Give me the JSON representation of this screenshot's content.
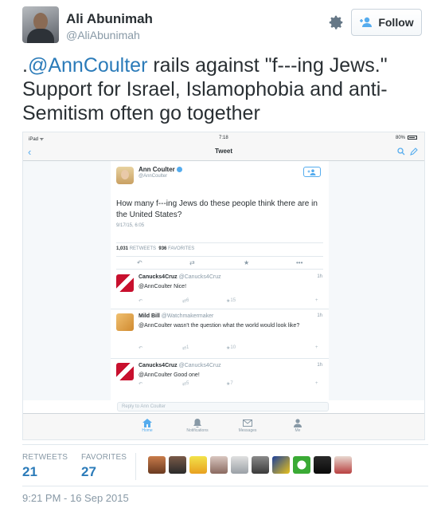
{
  "author": {
    "name": "Ali Abunimah",
    "handle": "@AliAbunimah",
    "follow_label": "Follow",
    "gear_icon": "gear-icon"
  },
  "tweet": {
    "prefix": ".",
    "mention": "@AnnCoulter",
    "text": " rails against \"f---ing Jews.\" Support for Israel, Islamophobia and anti-Semitism often go together"
  },
  "embedded": {
    "status_left": "iPad ᯤ",
    "status_time": "7:18",
    "status_battery": "80%",
    "nav_title": "Tweet",
    "main": {
      "name": "Ann Coulter",
      "handle": "@AnnCoulter",
      "text": "How many f---ing Jews do these people think there are in the United States?",
      "date": "9/17/15, 6:05",
      "retweets": "1,031",
      "retweets_label": "RETWEETS",
      "favorites": "936",
      "favorites_label": "FAVORITES"
    },
    "replies": [
      {
        "name": "Canucks4Cruz",
        "handle": "@Canucks4Cruz",
        "time": "1h",
        "text": "@AnnCoulter Nice!",
        "rt": "6",
        "fav": "15"
      },
      {
        "name": "Mild Bill",
        "handle": "@Watchmakermaker",
        "time": "1h",
        "text": "@AnnCoulter wasn't the question what the world would look like?",
        "rt": "1",
        "fav": "10"
      },
      {
        "name": "Canucks4Cruz",
        "handle": "@Canucks4Cruz",
        "time": "1h",
        "text": "@AnnCoulter Good one!",
        "rt": "5",
        "fav": "7"
      }
    ],
    "reply_placeholder": "Reply to Ann Coulter",
    "tabs": [
      "Home",
      "Notifications",
      "Messages",
      "Me"
    ]
  },
  "stats": {
    "retweets_label": "RETWEETS",
    "retweets": "21",
    "favorites_label": "FAVORITES",
    "favorites": "27"
  },
  "timestamp": "9:21 PM - 16 Sep 2015",
  "colors": {
    "link": "#2b7bb9",
    "accent": "#55acee",
    "muted": "#8899a6"
  }
}
